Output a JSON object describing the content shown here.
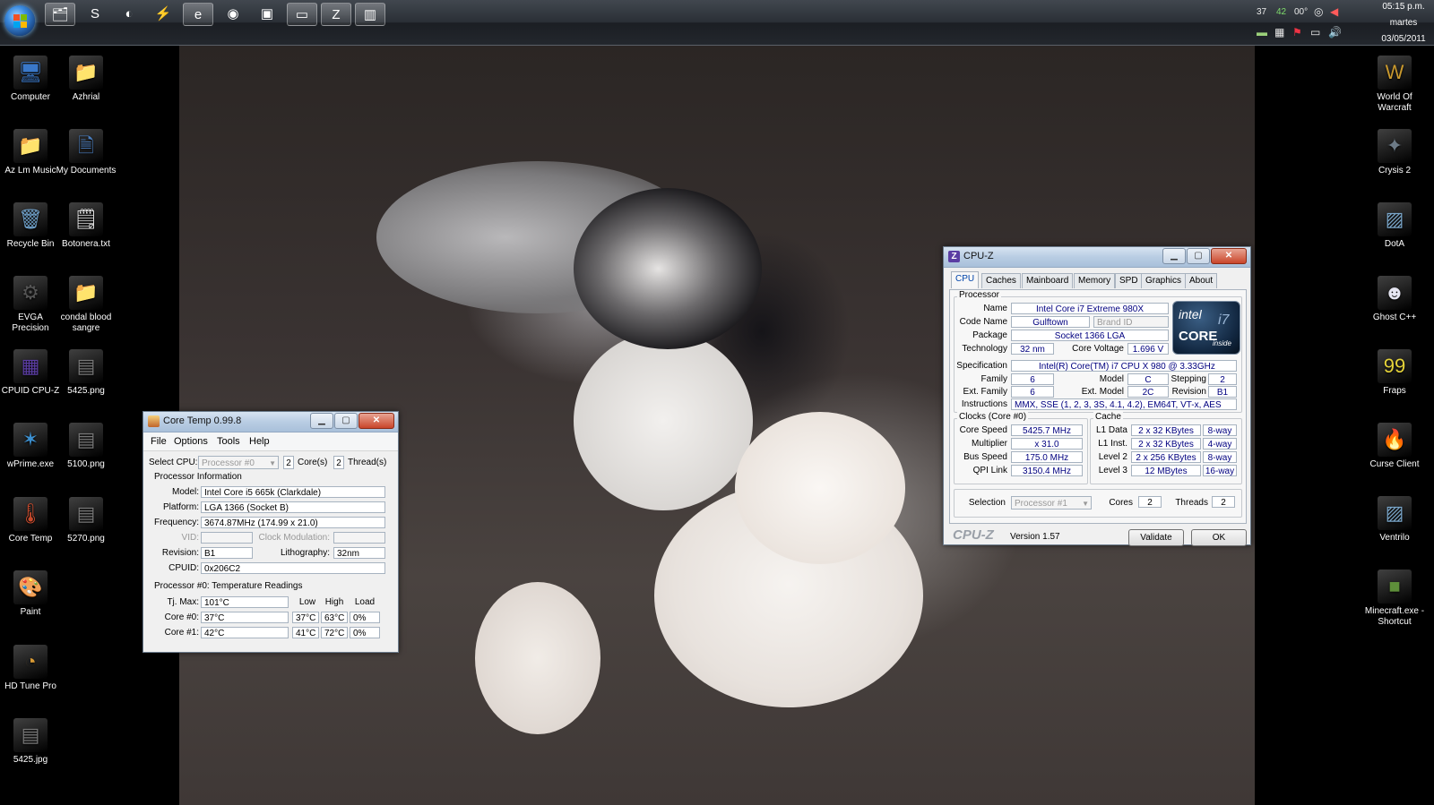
{
  "taskbar": {
    "pinned": [
      {
        "name": "explorer",
        "glyph": "🗂"
      },
      {
        "name": "skype",
        "glyph": "S"
      },
      {
        "name": "media",
        "glyph": "◐"
      },
      {
        "name": "winamp",
        "glyph": "⚡"
      },
      {
        "name": "ie",
        "glyph": "e"
      },
      {
        "name": "firefox",
        "glyph": "◉"
      },
      {
        "name": "switcher",
        "glyph": "▣"
      },
      {
        "name": "display",
        "glyph": "▭"
      },
      {
        "name": "cpuz",
        "glyph": "Z"
      },
      {
        "name": "coretemp",
        "glyph": "▥"
      }
    ],
    "tray": {
      "temp1": "37",
      "temp2": "42",
      "temp3": "00°"
    },
    "clock": {
      "time": "05:15 p.m.",
      "day": "martes",
      "date": "03/05/2011"
    }
  },
  "desktop_left": [
    {
      "label": "Computer",
      "icon": "computer-icon",
      "glyph": "🖥",
      "color": "#3a78c9"
    },
    {
      "label": "Azhrial",
      "icon": "folder-user-icon",
      "glyph": "📁",
      "color": "#d9b552"
    },
    {
      "label": "Az Lm Music",
      "icon": "folder-music-icon",
      "glyph": "📁",
      "color": "#caa843"
    },
    {
      "label": "My Documents",
      "icon": "documents-icon",
      "glyph": "🗎",
      "color": "#4a7fc2"
    },
    {
      "label": "Recycle Bin",
      "icon": "recycle-bin-icon",
      "glyph": "🗑",
      "color": "#6fa0c9"
    },
    {
      "label": "Botonera.txt",
      "icon": "text-file-icon",
      "glyph": "🗒",
      "color": "#eeeeee"
    },
    {
      "label": "EVGA Precision",
      "icon": "evga-icon",
      "glyph": "⚙",
      "color": "#555"
    },
    {
      "label": "condal blood sangre",
      "icon": "folder-icon",
      "glyph": "📁",
      "color": "#e2c067"
    },
    {
      "label": "CPUID CPU-Z",
      "icon": "cpuz-icon",
      "glyph": "▦",
      "color": "#5b3da3"
    },
    {
      "label": "5425.png",
      "icon": "image-file-icon",
      "glyph": "▤",
      "color": "#777"
    },
    {
      "label": "wPrime.exe",
      "icon": "wprime-icon",
      "glyph": "✶",
      "color": "#3c8fcf"
    },
    {
      "label": "5100.png",
      "icon": "image-file-icon",
      "glyph": "▤",
      "color": "#777"
    },
    {
      "label": "Core Temp",
      "icon": "thermometer-icon",
      "glyph": "🌡",
      "color": "#c84a2c"
    },
    {
      "label": "5270.png",
      "icon": "image-file-icon",
      "glyph": "▤",
      "color": "#777"
    },
    {
      "label": "Paint",
      "icon": "paint-icon",
      "glyph": "🎨",
      "color": "#4c8bd1"
    },
    {
      "label": "HD Tune Pro",
      "icon": "hd-tune-icon",
      "glyph": "◔",
      "color": "#d89a35"
    },
    {
      "label": "5425.jpg",
      "icon": "image-file-icon",
      "glyph": "▤",
      "color": "#777"
    }
  ],
  "desktop_right": [
    {
      "label": "World Of Warcraft",
      "icon": "wow-icon",
      "glyph": "W",
      "color": "#c9992e"
    },
    {
      "label": "Crysis 2",
      "icon": "crysis-icon",
      "glyph": "✦",
      "color": "#6c7a86"
    },
    {
      "label": "DotA",
      "icon": "dota-icon",
      "glyph": "▨",
      "color": "#7aa6c9"
    },
    {
      "label": "Ghost C++",
      "icon": "ghost-icon",
      "glyph": "☻",
      "color": "#e6e6f2"
    },
    {
      "label": "Fraps",
      "icon": "fraps-icon",
      "glyph": "99",
      "color": "#e5d33a"
    },
    {
      "label": "Curse Client",
      "icon": "curse-icon",
      "glyph": "🔥",
      "color": "#d65b1e"
    },
    {
      "label": "Ventrilo",
      "icon": "ventrilo-icon",
      "glyph": "▨",
      "color": "#7aa6c9"
    },
    {
      "label": "Minecraft.exe - Shortcut",
      "icon": "minecraft-icon",
      "glyph": "■",
      "color": "#5e8e3a"
    }
  ],
  "coretemp": {
    "title": "Core Temp 0.99.8",
    "menu": [
      "File",
      "Options",
      "Tools",
      "Help"
    ],
    "select_cpu_label": "Select CPU:",
    "select_cpu_value": "Processor #0",
    "cores_value": "2",
    "cores_label": "Core(s)",
    "threads_value": "2",
    "threads_label": "Thread(s)",
    "proc_info_label": "Processor Information",
    "model_label": "Model:",
    "model": "Intel Core i5 665k (Clarkdale)",
    "platform_label": "Platform:",
    "platform": "LGA 1366 (Socket B)",
    "frequency_label": "Frequency:",
    "frequency": "3674.87MHz (174.99 x 21.0)",
    "vid_label": "VID:",
    "vid": "",
    "clockmod_label": "Clock Modulation:",
    "clockmod": "",
    "revision_label": "Revision:",
    "revision": "B1",
    "litho_label": "Lithography:",
    "litho": "32nm",
    "cpuid_label": "CPUID:",
    "cpuid": "0x206C2",
    "temps_label": "Processor #0: Temperature Readings",
    "tjmax_label": "Tj. Max:",
    "tjmax": "101°C",
    "col_low": "Low",
    "col_high": "High",
    "col_load": "Load",
    "cores": [
      {
        "label": "Core #0:",
        "temp": "37°C",
        "low": "37°C",
        "high": "63°C",
        "load": "0%"
      },
      {
        "label": "Core #1:",
        "temp": "42°C",
        "low": "41°C",
        "high": "72°C",
        "load": "0%"
      }
    ]
  },
  "cpuz": {
    "title": "CPU-Z",
    "tabs": [
      "CPU",
      "Caches",
      "Mainboard",
      "Memory",
      "SPD",
      "Graphics",
      "About"
    ],
    "processor_group": "Processor",
    "name_label": "Name",
    "name": "Intel Core i7 Extreme 980X",
    "codename_label": "Code Name",
    "codename": "Gulftown",
    "brandid_label": "Brand ID",
    "package_label": "Package",
    "package": "Socket 1366 LGA",
    "tech_label": "Technology",
    "tech": "32 nm",
    "corev_label": "Core Voltage",
    "corev": "1.696 V",
    "spec_label": "Specification",
    "spec": "Intel(R) Core(TM) i7 CPU        X 980  @ 3.33GHz",
    "family_label": "Family",
    "family": "6",
    "model_label": "Model",
    "model": "C",
    "stepping_label": "Stepping",
    "stepping": "2",
    "extfamily_label": "Ext. Family",
    "extfamily": "6",
    "extmodel_label": "Ext. Model",
    "extmodel": "2C",
    "revision_label": "Revision",
    "revision": "B1",
    "instr_label": "Instructions",
    "instr": "MMX, SSE (1, 2, 3, 3S, 4.1, 4.2), EM64T, VT-x, AES",
    "clocks_group": "Clocks (Core #0)",
    "corespeed_label": "Core Speed",
    "corespeed": "5425.7 MHz",
    "mult_label": "Multiplier",
    "mult": "x 31.0",
    "bus_label": "Bus Speed",
    "bus": "175.0 MHz",
    "qpi_label": "QPI Link",
    "qpi": "3150.4 MHz",
    "cache_group": "Cache",
    "l1d_label": "L1 Data",
    "l1d": "2 x 32 KBytes",
    "l1d_way": "8-way",
    "l1i_label": "L1 Inst.",
    "l1i": "2 x 32 KBytes",
    "l1i_way": "4-way",
    "l2_label": "Level 2",
    "l2": "2 x 256 KBytes",
    "l2_way": "8-way",
    "l3_label": "Level 3",
    "l3": "12 MBytes",
    "l3_way": "16-way",
    "selection_label": "Selection",
    "selection": "Processor #1",
    "cores_label": "Cores",
    "cores": "2",
    "threads_label": "Threads",
    "threads": "2",
    "brand": "CPU-Z",
    "version": "Version 1.57",
    "validate_label": "Validate",
    "ok_label": "OK",
    "logo_intel": "intel",
    "logo_core": "CORE",
    "logo_i7": "i7",
    "logo_inside": "inside"
  }
}
